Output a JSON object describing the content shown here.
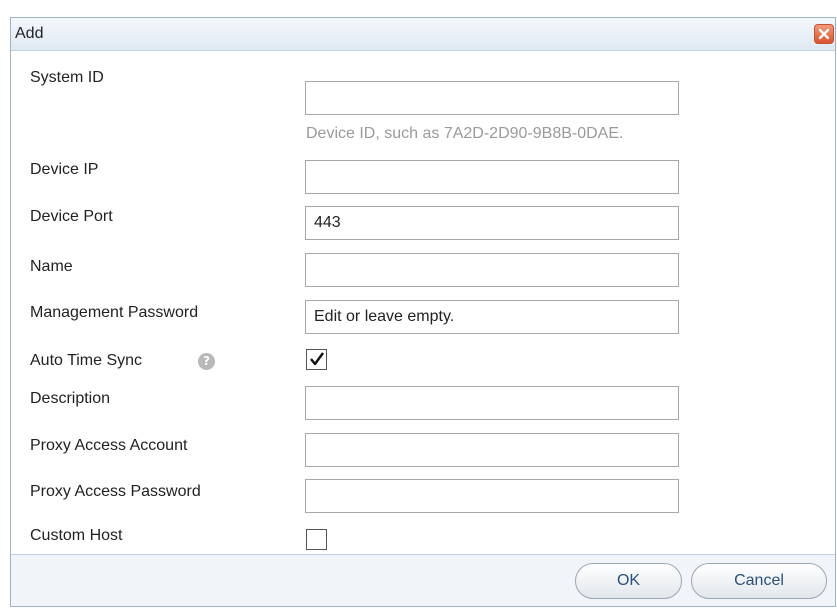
{
  "dialog": {
    "title": "Add",
    "close_icon": "close-icon"
  },
  "fields": {
    "system_id": {
      "label": "System ID",
      "value": "",
      "hint": "Device ID, such as 7A2D-2D90-9B8B-0DAE."
    },
    "device_ip": {
      "label": "Device IP",
      "value": ""
    },
    "device_port": {
      "label": "Device Port",
      "value": "443"
    },
    "name": {
      "label": "Name",
      "value": ""
    },
    "management_password": {
      "label": "Management Password",
      "value": "",
      "placeholder": "Edit or leave empty."
    },
    "auto_time_sync": {
      "label": "Auto Time Sync",
      "checked": true,
      "help_icon": "help-icon"
    },
    "description": {
      "label": "Description",
      "value": ""
    },
    "proxy_access_account": {
      "label": "Proxy Access Account",
      "value": ""
    },
    "proxy_access_password": {
      "label": "Proxy Access Password",
      "value": ""
    },
    "custom_host": {
      "label": "Custom Host",
      "checked": false
    }
  },
  "buttons": {
    "ok": "OK",
    "cancel": "Cancel"
  },
  "colors": {
    "titlebar": "#dfe8f2",
    "close": "#d9532c",
    "hint_text": "#9a9a9a",
    "button_text": "#2a4f7d",
    "footer": "#f1f5f9"
  }
}
